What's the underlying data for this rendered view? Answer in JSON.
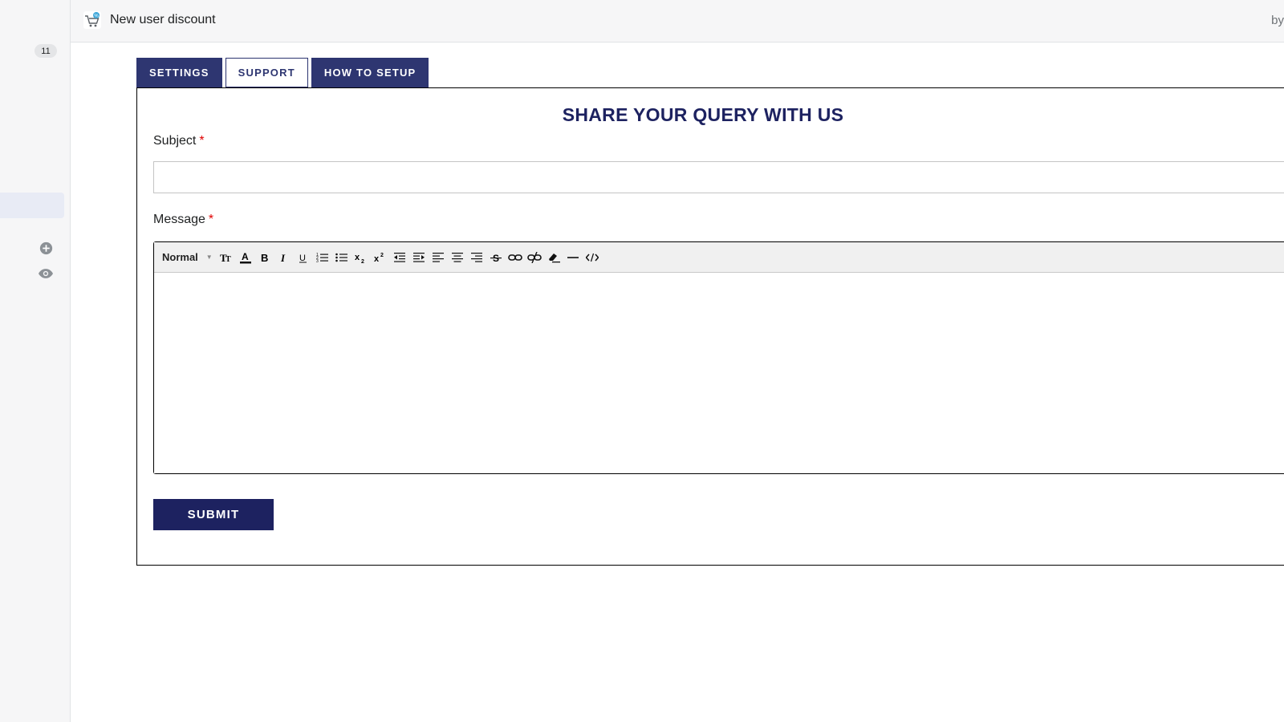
{
  "sidebar": {
    "badge_count": "11",
    "icons": [
      "add-circle-icon",
      "eye-icon"
    ]
  },
  "topbar": {
    "app_title": "New user discount",
    "right_text": "by",
    "app_icon": "cart-icon"
  },
  "tabs": [
    {
      "label": "SETTINGS",
      "active": false
    },
    {
      "label": "SUPPORT",
      "active": true
    },
    {
      "label": "HOW TO SETUP",
      "active": false
    }
  ],
  "support_form": {
    "title": "SHARE YOUR QUERY WITH US",
    "subject_label": "Subject",
    "subject_value": "",
    "message_label": "Message",
    "required_mark": "*",
    "toolbar": {
      "format_select": "Normal",
      "buttons": [
        "text-size-icon",
        "text-color-icon",
        "bold-icon",
        "italic-icon",
        "underline-icon",
        "ordered-list-icon",
        "bullet-list-icon",
        "subscript-icon",
        "superscript-icon",
        "outdent-icon",
        "indent-icon",
        "align-left-icon",
        "align-center-icon",
        "align-right-icon",
        "strikethrough-icon",
        "link-icon",
        "unlink-icon",
        "clear-format-icon",
        "horizontal-rule-icon",
        "code-view-icon"
      ]
    },
    "message_value": "",
    "submit_label": "SUBMIT"
  },
  "colors": {
    "brand_dark": "#1d2260",
    "tab_dark": "#2e3671",
    "required": "#e00000"
  }
}
